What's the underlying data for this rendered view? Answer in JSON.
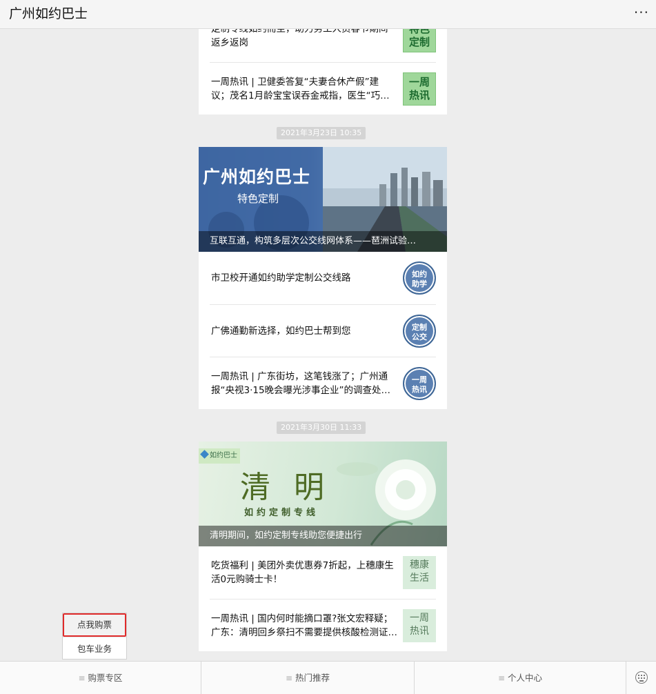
{
  "header": {
    "title": "广州如约巴士",
    "more_label": "···"
  },
  "posts": [
    {
      "items": [
        {
          "line1": "定制专线如约而至，助力务工人员春节期间",
          "line2": "返乡返岗",
          "thumb_lines": [
            "特色",
            "定制"
          ]
        },
        {
          "line1": "一周热讯 | 卫健委答复“夫妻合休产假”建",
          "line2": "议；茂名1月龄宝宝误吞金戒指，医生“巧…",
          "thumb_lines": [
            "一周",
            "热讯"
          ]
        }
      ]
    },
    {
      "time": "2021年3月23日 10:35",
      "cover": {
        "brand": "广州如约巴士",
        "sub": "特色定制",
        "caption": "互联互通，构筑多层次公交线网体系——琶洲试验…"
      },
      "items": [
        {
          "line1": "市卫校开通如约助学定制公交线路",
          "line2": "",
          "thumb_lines": [
            "如约",
            "助学"
          ]
        },
        {
          "line1": "广佛通勤新选择，如约巴士帮到您",
          "line2": "",
          "thumb_lines": [
            "定制",
            "公交"
          ]
        },
        {
          "line1": "一周热讯 | 广东街坊，这笔钱涨了；广州通",
          "line2": "报“央视3·15晚会曝光涉事企业”的调查处…",
          "thumb_lines": [
            "一周",
            "热讯"
          ]
        }
      ]
    },
    {
      "time": "2021年3月30日 11:33",
      "cover": {
        "logo": "如约巴士",
        "big": "清 明",
        "sub": "如约定制专线",
        "caption": "清明期间，如约定制专线助您便捷出行"
      },
      "items": [
        {
          "line1": "吃货福利 | 美团外卖优惠券7折起，上穗康生",
          "line2": "活0元购骑士卡！",
          "thumb_lines": [
            "穗康",
            "生活"
          ]
        },
        {
          "line1": "一周热讯 | 国内何时能摘口罩?张文宏释疑；",
          "line2": "广东：清明回乡祭扫不需要提供核酸检测证…",
          "thumb_lines": [
            "一周",
            "热讯"
          ]
        }
      ]
    }
  ],
  "popup": {
    "items": [
      "点我购票",
      "包车业务"
    ]
  },
  "bottom_menu": {
    "tabs": [
      "购票专区",
      "热门推荐",
      "个人中心"
    ],
    "menu_icon": "hamburger-icon",
    "keyboard_icon": "keyboard-icon"
  },
  "colors": {
    "highlight": "#e02a2a",
    "circle_blue": "#5b80b2",
    "green_thumb": "#9fd79a"
  }
}
